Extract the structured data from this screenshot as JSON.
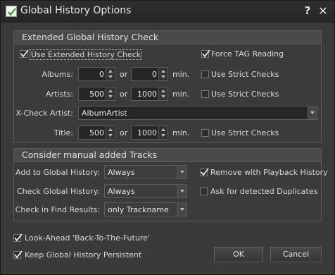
{
  "window": {
    "title": "Global History Options",
    "help_label": "?",
    "close_label": "✕"
  },
  "extended": {
    "title": "Extended Global History Check",
    "use_extended": {
      "label": "Use Extended History Check",
      "checked": true
    },
    "force_tag": {
      "label": "Force TAG Reading",
      "checked": true
    },
    "or_label": "or",
    "min_label": "min.",
    "strict_label": "Use Strict Checks",
    "albums": {
      "label": "Albums:",
      "min": "0",
      "max": "0",
      "strict": false
    },
    "artists": {
      "label": "Artists:",
      "min": "500",
      "max": "1000",
      "strict": false
    },
    "xcheck": {
      "label": "X-Check Artist:",
      "value": "AlbumArtist"
    },
    "title_row": {
      "label": "Title:",
      "min": "500",
      "max": "1000",
      "strict": false
    }
  },
  "manual": {
    "title": "Consider manual added Tracks",
    "add_global": {
      "label": "Add to Global History:",
      "value": "Always"
    },
    "check_global": {
      "label": "Check Global History:",
      "value": "Always"
    },
    "check_find": {
      "label": "Check in Find Results:",
      "value": "only Trackname"
    },
    "remove_playback": {
      "label": "Remove with Playback History",
      "checked": true
    },
    "ask_duplicates": {
      "label": "Ask for detected Duplicates",
      "checked": false
    }
  },
  "footer": {
    "look_ahead": {
      "label": "Look-Ahead 'Back-To-The-Future'",
      "checked": true
    },
    "keep_persistent": {
      "label": "Keep Global History Persistent",
      "checked": true
    },
    "ok_label": "OK",
    "cancel_label": "Cancel"
  },
  "colors": {
    "background": "#3a3a3a",
    "titlebar": "#262626",
    "group_header": "#4a4a4a",
    "text": "#d8d8d8"
  }
}
